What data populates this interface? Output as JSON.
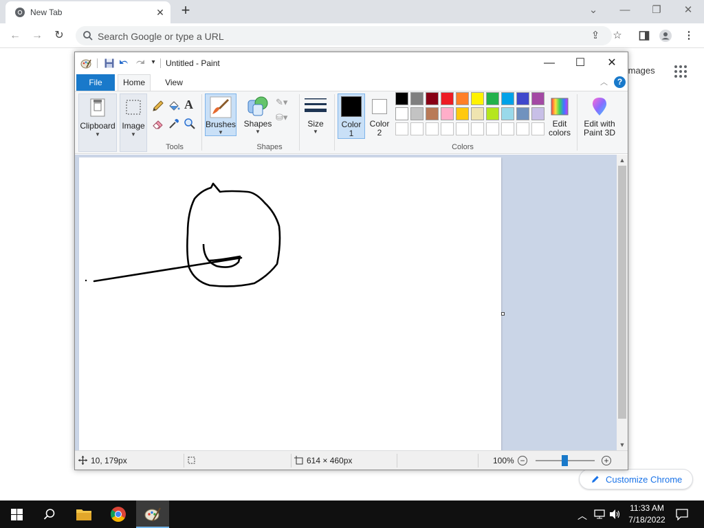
{
  "chrome": {
    "tab_title": "New Tab",
    "tab_close": "✕",
    "new_tab": "+",
    "omnibox_placeholder": "Search Google or type a URL",
    "ntp_images": "Images",
    "customize_label": "Customize Chrome"
  },
  "paint": {
    "window_title": "Untitled - Paint",
    "tabs": {
      "file": "File",
      "home": "Home",
      "view": "View"
    },
    "help": "?",
    "ribbon": {
      "clipboard": "Clipboard",
      "image": "Image",
      "tools_group": "Tools",
      "brushes": "Brushes",
      "shapes": "Shapes",
      "shapes_group": "Shapes",
      "size": "Size",
      "color1_line1": "Color",
      "color1_line2": "1",
      "color2_line1": "Color",
      "color2_line2": "2",
      "edit_colors_line1": "Edit",
      "edit_colors_line2": "colors",
      "paint3d_line1": "Edit with",
      "paint3d_line2": "Paint 3D",
      "colors_group": "Colors"
    },
    "palette_row1": [
      "#000000",
      "#7f7f7f",
      "#880015",
      "#ed1c24",
      "#ff7f27",
      "#fff200",
      "#22b14c",
      "#00a2e8",
      "#3f48cc",
      "#a349a4"
    ],
    "palette_row2": [
      "#ffffff",
      "#c3c3c3",
      "#b97a57",
      "#ffaec9",
      "#ffc90e",
      "#efe4b0",
      "#b5e61d",
      "#99d9ea",
      "#7092be",
      "#c8bfe7"
    ],
    "color1": "#000000",
    "color2": "#ffffff",
    "status": {
      "cursor_pos": "10, 179px",
      "image_size": "614 × 460px",
      "zoom": "100%"
    },
    "zoom_level_percent": 100
  },
  "taskbar": {
    "time": "11:33 AM",
    "date": "7/18/2022"
  }
}
